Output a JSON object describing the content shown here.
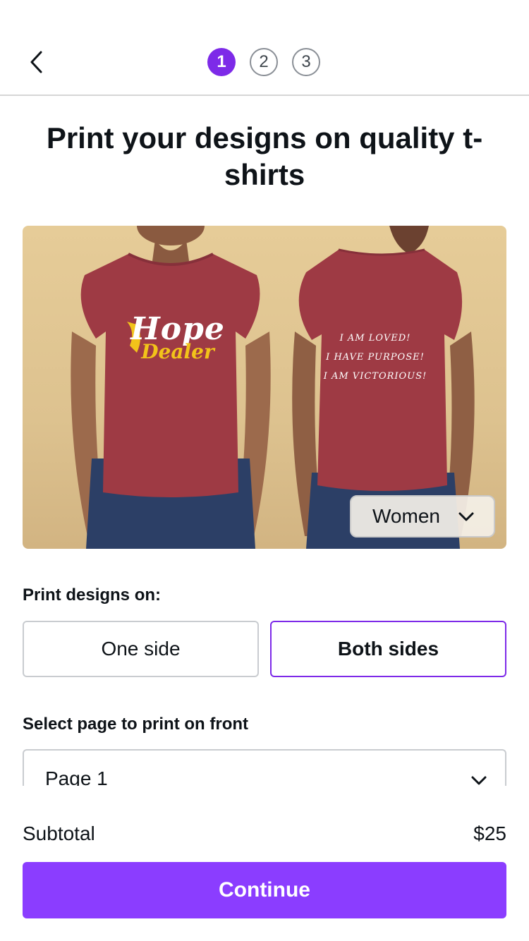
{
  "header": {
    "back_icon": "chevron-left-icon",
    "steps": [
      {
        "label": "1",
        "active": true
      },
      {
        "label": "2",
        "active": false
      },
      {
        "label": "3",
        "active": false
      }
    ]
  },
  "title": "Print your designs on quality t-shirts",
  "product": {
    "front_print": {
      "line1": "Hope",
      "line2": "Dealer"
    },
    "back_print": [
      "I AM LOVED!",
      "I HAVE PURPOSE!",
      "I AM VICTORIOUS!"
    ],
    "gender_select": {
      "value": "Women",
      "icon": "chevron-down-icon"
    },
    "shirt_color": "#9e3a44",
    "background_color": "#e2c794"
  },
  "print_sides": {
    "label": "Print designs on:",
    "options": [
      {
        "label": "One side",
        "selected": false
      },
      {
        "label": "Both sides",
        "selected": true
      }
    ]
  },
  "front_page": {
    "label": "Select page to print on front",
    "value": "Page 1",
    "icon": "chevron-down-icon"
  },
  "footer": {
    "subtotal_label": "Subtotal",
    "subtotal_value": "$25",
    "continue_label": "Continue"
  },
  "colors": {
    "accent": "#7d2ae8",
    "button": "#8b3dff"
  }
}
